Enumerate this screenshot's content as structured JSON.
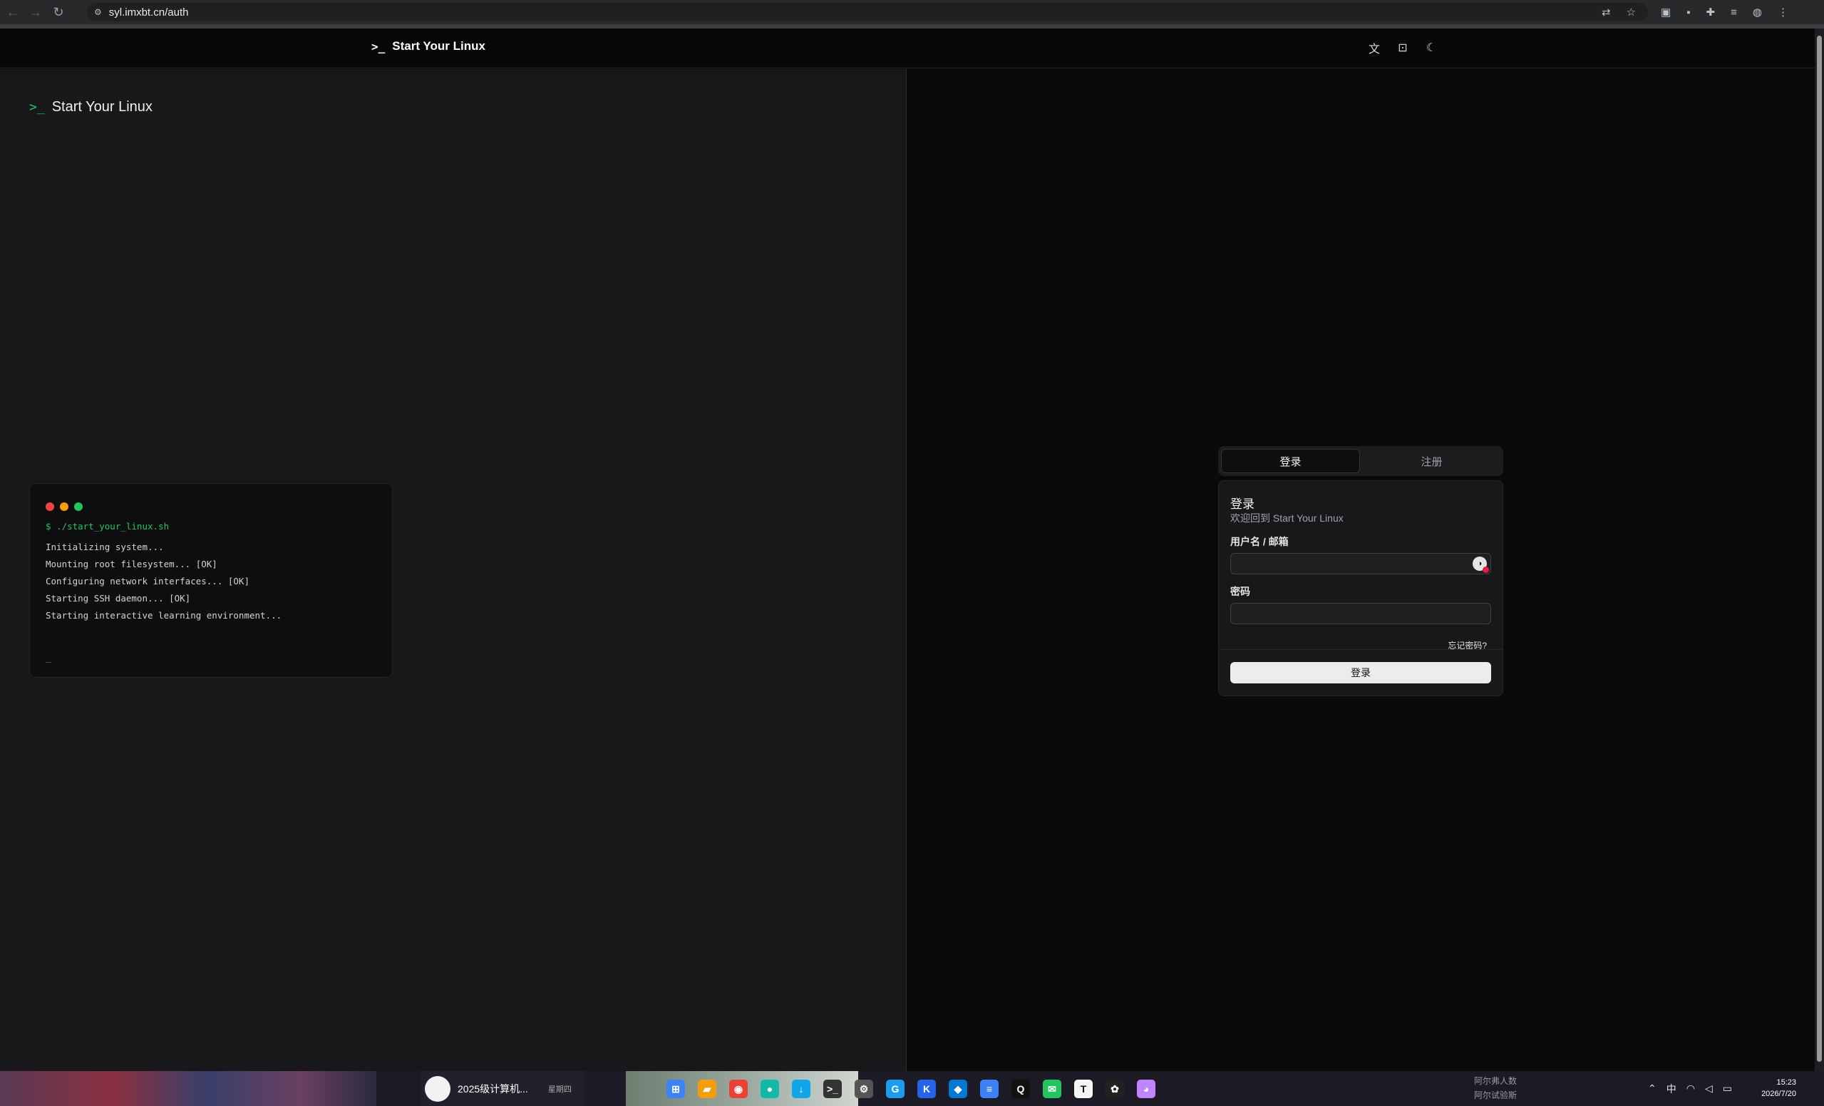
{
  "browser": {
    "url": "syl.imxbt.cn/auth",
    "nav_icons": [
      "back-arrow-icon",
      "forward-arrow-icon",
      "reload-icon"
    ],
    "toolbar_icons": [
      "translate-icon",
      "bookmark-star-icon",
      "extension-icon",
      "extension-icon",
      "puzzle-icon",
      "media-icon",
      "profile-icon",
      "menu-icon"
    ]
  },
  "header": {
    "prompt_glyph": ">_",
    "brand": "Start Your Linux",
    "icons": [
      "translate-icon",
      "terminal-icon",
      "moon-icon"
    ]
  },
  "left": {
    "prompt_glyph": ">_",
    "brand": "Start Your Linux",
    "terminal": {
      "dot_colors": [
        "#ef4444",
        "#f59e0b",
        "#22c55e"
      ],
      "command": "$ ./start_your_linux.sh",
      "lines": [
        "Initializing system...",
        "Mounting root filesystem... [OK]",
        "Configuring network interfaces... [OK]",
        "Starting SSH daemon... [OK]",
        "Starting interactive learning environment..."
      ],
      "cursor": "_"
    }
  },
  "auth": {
    "tabs": [
      "登录",
      "注册"
    ],
    "active_tab": "登录",
    "title": "登录",
    "subtitle": "欢迎回到 Start Your Linux",
    "username_label": "用户名 / 邮箱",
    "username_value": "",
    "password_label": "密码",
    "password_value": "",
    "forgot": "忘记密码?",
    "submit": "登录"
  },
  "taskbar": {
    "notification_title": "2025级计算机...",
    "notification_day": "星期四",
    "apps": [
      {
        "name": "windows-start-icon",
        "glyph": "⊞",
        "color": "#3b82f6"
      },
      {
        "name": "file-explorer-icon",
        "glyph": "▰",
        "color": "#f59e0b"
      },
      {
        "name": "chrome-icon",
        "glyph": "◉",
        "color": "#ea4335"
      },
      {
        "name": "app-icon",
        "glyph": "●",
        "color": "#14b8a6"
      },
      {
        "name": "download-icon",
        "glyph": "↓",
        "color": "#0ea5e9"
      },
      {
        "name": "terminal-icon",
        "glyph": ">_",
        "color": "#333333"
      },
      {
        "name": "settings-icon",
        "glyph": "⚙",
        "color": "#555555"
      },
      {
        "name": "grammarly-icon",
        "glyph": "G",
        "color": "#1d9bf0"
      },
      {
        "name": "k-app-icon",
        "glyph": "K",
        "color": "#2563eb"
      },
      {
        "name": "vscode-icon",
        "glyph": "◆",
        "color": "#0078d4"
      },
      {
        "name": "notepad-icon",
        "glyph": "≡",
        "color": "#3b82f6"
      },
      {
        "name": "qq-icon",
        "glyph": "Q",
        "color": "#111111"
      },
      {
        "name": "wechat-icon",
        "glyph": "✉",
        "color": "#22c55e"
      },
      {
        "name": "typora-icon",
        "glyph": "T",
        "color": "#f4f4f5"
      },
      {
        "name": "chatgpt-icon",
        "glyph": "✿",
        "color": "#222222"
      },
      {
        "name": "cat-app-icon",
        "glyph": "◕",
        "color": "#c084fc"
      }
    ],
    "chat_items": [
      "阿尔弗人数",
      "阿尔试验斯"
    ],
    "tray_icons": [
      "chevron-up-icon",
      "ime-icon",
      "wifi-icon",
      "volume-icon",
      "battery-icon"
    ],
    "ime": "中",
    "time": "15:23",
    "date": "2026/7/20"
  }
}
